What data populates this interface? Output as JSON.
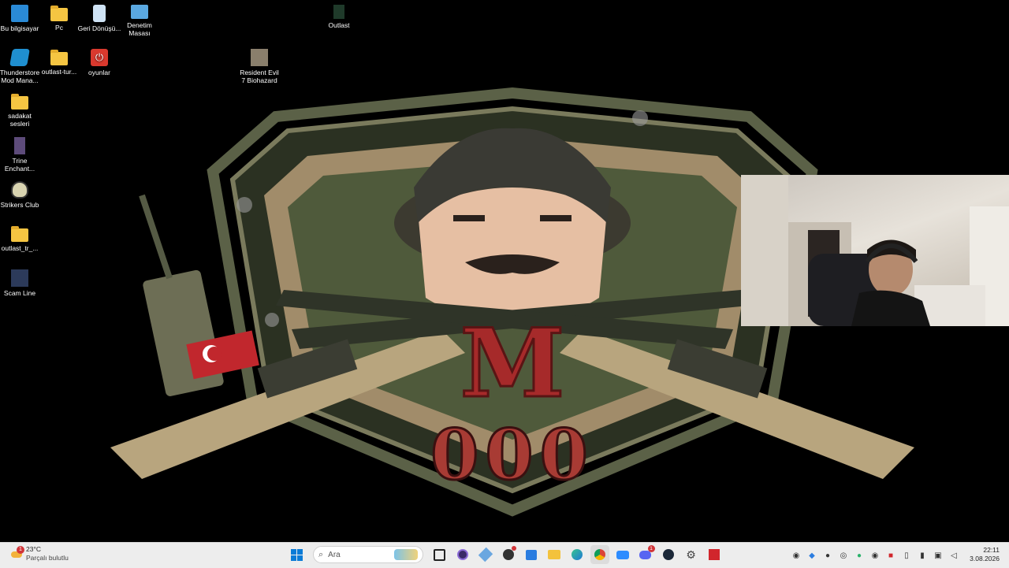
{
  "desktop_icons": [
    {
      "label": "Bu bilgisayar",
      "icon": "computer-icon"
    },
    {
      "label": "Pc",
      "icon": "folder-icon"
    },
    {
      "label": "Geri Dönüşü...",
      "icon": "recycle-bin-icon"
    },
    {
      "label": "Denetim Masası",
      "icon": "control-panel-icon"
    },
    {
      "label": "Outlast",
      "icon": "game-shortcut-icon"
    },
    {
      "label": "Thunderstore Mod Mana...",
      "icon": "thunderstore-icon"
    },
    {
      "label": "outlast-tur...",
      "icon": "folder-icon"
    },
    {
      "label": "oyunlar",
      "icon": "power-icon"
    },
    {
      "label": "Resident Evil 7 Biohazard",
      "icon": "game-shortcut-icon"
    },
    {
      "label": "sadakat sesleri",
      "icon": "folder-icon"
    },
    {
      "label": "Trine Enchant...",
      "icon": "game-shortcut-icon"
    },
    {
      "label": "Strikers Club",
      "icon": "strikers-club-icon"
    },
    {
      "label": "outlast_tr_...",
      "icon": "folder-icon"
    },
    {
      "label": "Scam Line",
      "icon": "game-shortcut-icon"
    }
  ],
  "wallpaper": {
    "letter": "M",
    "number": "000"
  },
  "taskbar": {
    "weather": {
      "temp": "23°C",
      "condition": "Parçalı bulutlu",
      "badge": "1"
    },
    "search_placeholder": "Ara",
    "pinned": [
      "windows-start-icon",
      "search-icon",
      "task-view-icon",
      "obs-icon",
      "app-icon",
      "chrome-dev-icon",
      "store-icon",
      "file-explorer-icon",
      "edge-icon",
      "chrome-icon",
      "zoom-icon",
      "discord-icon",
      "steam-icon",
      "settings-icon",
      "amd-icon"
    ],
    "discord_badge": "1",
    "clock": {
      "time": "22:11",
      "date": "3.08.2026"
    }
  }
}
